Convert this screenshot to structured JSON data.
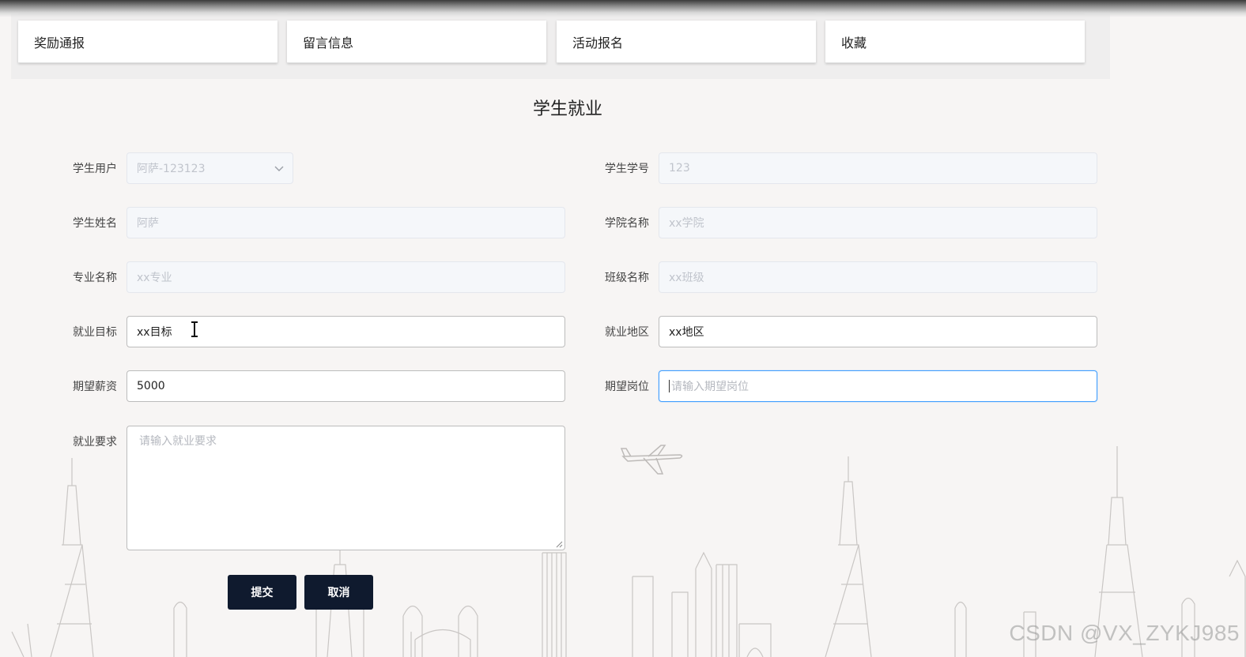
{
  "nav": {
    "items": [
      "奖励通报",
      "留言信息",
      "活动报名",
      "收藏"
    ]
  },
  "page": {
    "title": "学生就业"
  },
  "form": {
    "student_user": {
      "label": "学生用户",
      "value": "阿萨-123123"
    },
    "student_no": {
      "label": "学生学号",
      "value": "123"
    },
    "student_name": {
      "label": "学生姓名",
      "value": "阿萨"
    },
    "college_name": {
      "label": "学院名称",
      "value": "xx学院"
    },
    "major_name": {
      "label": "专业名称",
      "value": "xx专业"
    },
    "class_name": {
      "label": "班级名称",
      "value": "xx班级"
    },
    "job_goal": {
      "label": "就业目标",
      "value": "xx目标"
    },
    "job_region": {
      "label": "就业地区",
      "value": "xx地区"
    },
    "expected_salary": {
      "label": "期望薪资",
      "value": "5000"
    },
    "expected_position": {
      "label": "期望岗位",
      "placeholder": "请输入期望岗位"
    },
    "job_requirement": {
      "label": "就业要求",
      "placeholder": "请输入就业要求"
    }
  },
  "buttons": {
    "submit": "提交",
    "cancel": "取消"
  },
  "watermark": "CSDN @VX_ZYKJ985",
  "colors": {
    "button_bg": "#0f1a2e",
    "focus_border": "#409eff",
    "page_bg": "#f7f5f4"
  }
}
